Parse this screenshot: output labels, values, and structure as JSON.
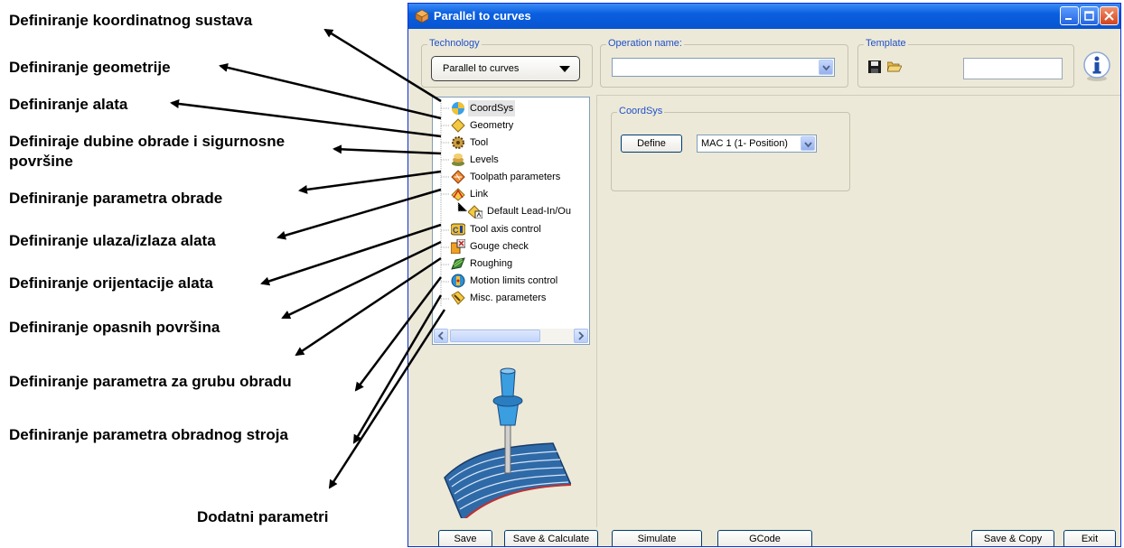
{
  "annotations": [
    "Definiranje koordinatnog sustava",
    "Definiranje geometrije",
    "Definiranje alata",
    "Definiraje dubine obrade i sigurnosne",
    "površine",
    "Definiranje parametra obrade",
    "Definiranje ulaza/izlaza alata",
    "Definiranje orijentacije alata",
    "Definiranje opasnih površina",
    "Definiranje parametra za grubu obradu",
    "Definiranje parametra obradnog stroja",
    "Dodatni parametri"
  ],
  "window": {
    "title": "Parallel to curves",
    "title_icon": "cube-icon",
    "controls": [
      "minimize-icon",
      "maximize-icon",
      "close-icon"
    ]
  },
  "technology": {
    "label": "Technology",
    "value": "Parallel to curves"
  },
  "operation": {
    "label": "Operation name:",
    "value": ""
  },
  "template": {
    "label": "Template",
    "icons": [
      "save-disk-icon",
      "open-folder-icon"
    ],
    "value": ""
  },
  "info_icon": "info-icon",
  "tree": {
    "items": [
      {
        "label": "CoordSys",
        "icon": "coordsys-icon",
        "selected": true
      },
      {
        "label": "Geometry",
        "icon": "geometry-icon"
      },
      {
        "label": "Tool",
        "icon": "tool-icon"
      },
      {
        "label": "Levels",
        "icon": "levels-icon"
      },
      {
        "label": "Toolpath parameters",
        "icon": "toolpath-icon"
      },
      {
        "label": "Link",
        "icon": "link-icon"
      },
      {
        "label": "Default Lead-In/Ou",
        "icon": "leadin-icon"
      },
      {
        "label": "Tool axis control",
        "icon": "tool-axis-icon"
      },
      {
        "label": "Gouge check",
        "icon": "gouge-icon"
      },
      {
        "label": "Roughing",
        "icon": "roughing-icon"
      },
      {
        "label": "Motion limits control",
        "icon": "motion-limits-icon"
      },
      {
        "label": "Misc. parameters",
        "icon": "misc-icon"
      }
    ]
  },
  "coordsys": {
    "label": "CoordSys",
    "define_button": "Define",
    "select_value": "MAC 1 (1- Position)"
  },
  "footer": {
    "save": "Save",
    "save_calc": "Save & Calculate",
    "simulate": "Simulate",
    "gcode": "GCode",
    "save_copy": "Save & Copy",
    "exit": "Exit"
  },
  "colors": {
    "titlebar": "#0a5fe0",
    "window_bg": "#ece9d8",
    "group_label": "#2050c8"
  }
}
